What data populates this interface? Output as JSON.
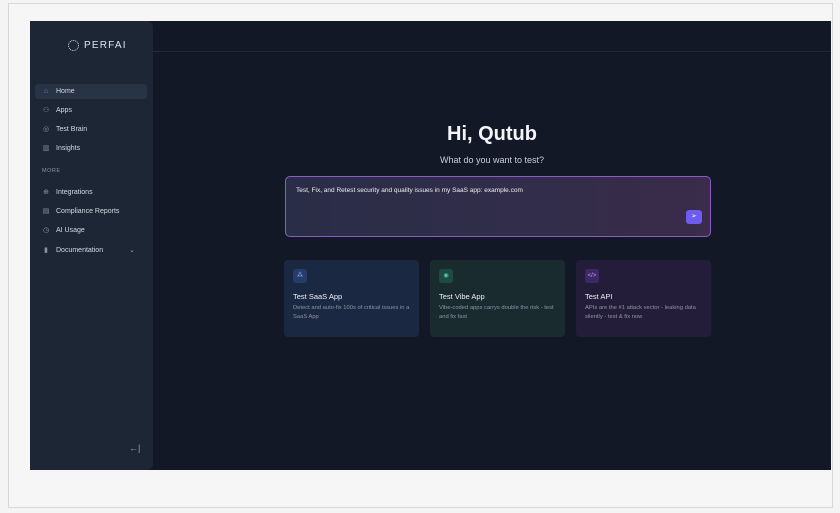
{
  "brand": {
    "name": "PERFAI"
  },
  "sidebar": {
    "items": [
      {
        "label": "Home",
        "icon": "home-icon",
        "glyph": "⌂"
      },
      {
        "label": "Apps",
        "icon": "apps-icon",
        "glyph": "⚇"
      },
      {
        "label": "Test Brain",
        "icon": "brain-icon",
        "glyph": "◎"
      },
      {
        "label": "Insights",
        "icon": "chart-icon",
        "glyph": "▥"
      }
    ],
    "section_label": "MORE",
    "more_items": [
      {
        "label": "Integrations",
        "icon": "globe-icon",
        "glyph": "⊕"
      },
      {
        "label": "Compliance Reports",
        "icon": "clipboard-icon",
        "glyph": "▤"
      },
      {
        "label": "AI Usage",
        "icon": "gauge-icon",
        "glyph": "◷"
      },
      {
        "label": "Documentation",
        "icon": "doc-icon",
        "glyph": "▮"
      }
    ],
    "collapse_glyph": "←|"
  },
  "main": {
    "greeting": "Hi, Qutub",
    "subtitle": "What do you want to test?",
    "prompt_value": "Test, Fix, and Retest security and quality issues in my SaaS app: example.com",
    "send_glyph": "➢"
  },
  "cards": [
    {
      "title": "Test SaaS App",
      "description": "Detect and auto-fix 100s of critical issues in a SaaS App",
      "glyph": "⁂"
    },
    {
      "title": "Test Vibe App",
      "description": "Vibe-coded apps carrys double the risk - test and fix fast",
      "glyph": "◉"
    },
    {
      "title": "Test API",
      "description": "APIs are the #1 attack vector - leaking data silently - test & fix now",
      "glyph": "</>"
    }
  ],
  "colors": {
    "accent": "#6d5cf0",
    "app_bg": "#121826",
    "sidebar_bg": "#1d2634"
  }
}
